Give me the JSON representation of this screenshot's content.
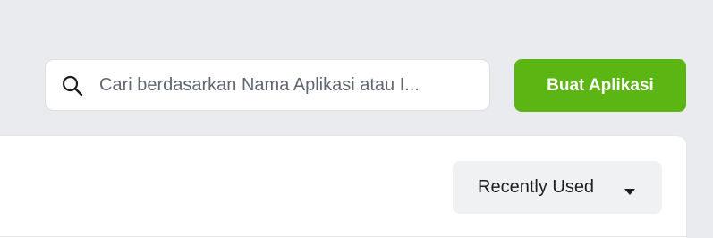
{
  "search": {
    "placeholder": "Cari berdasarkan Nama Aplikasi atau I...",
    "icon": "search-icon"
  },
  "header": {
    "create_app_label": "Buat Aplikasi"
  },
  "sort": {
    "selected_label": "Recently Used",
    "icon": "caret-down-icon"
  },
  "colors": {
    "page_background": "#e9ebee",
    "primary_button": "#5bb512",
    "panel_background": "#ffffff",
    "dropdown_background": "#f0f1f2",
    "text": "#1c1e21",
    "placeholder_text": "#606770"
  }
}
